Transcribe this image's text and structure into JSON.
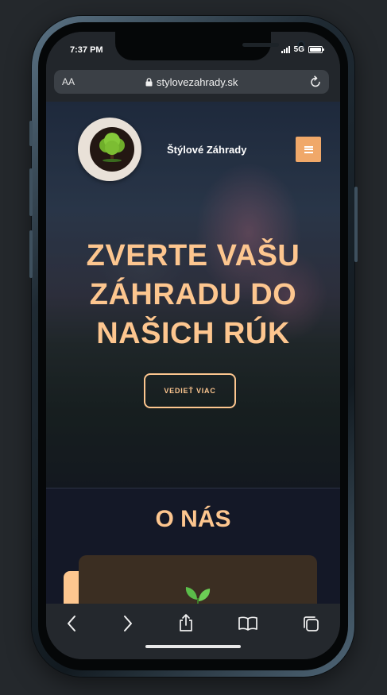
{
  "status_bar": {
    "time": "7:37 PM",
    "network": "5G"
  },
  "browser": {
    "text_size_label": "AA",
    "url": "stylovezahrady.sk"
  },
  "site": {
    "brand_name": "Štýlové Záhrady",
    "hero_headline": "ZVERTE VAŠU ZÁHRADU DO NAŠICH RÚK",
    "cta_label": "VEDIEŤ VIAC",
    "about_title": "O NÁS"
  },
  "colors": {
    "accent": "#fdc68f",
    "menu_button": "#f0a869",
    "page_bg": "#141827"
  },
  "icons": {
    "browser": [
      "lock-icon",
      "reload-icon"
    ],
    "toolbar": [
      "back-icon",
      "forward-icon",
      "share-icon",
      "bookmarks-icon",
      "tabs-icon"
    ]
  }
}
